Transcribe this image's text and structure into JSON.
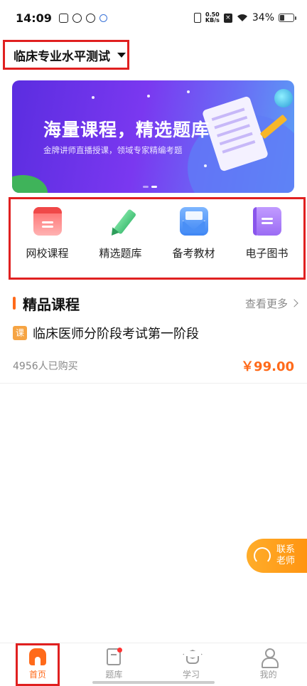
{
  "status_bar": {
    "time": "14:09",
    "net_speed_value": "0.50",
    "net_speed_unit": "KB/s",
    "battery": "34%",
    "battery_level": 0.34
  },
  "header": {
    "exam_selector": "临床专业水平测试"
  },
  "banner": {
    "title": "海量课程，精选题库",
    "subtitle": "金牌讲师直播授课，领域专家精编考题"
  },
  "quick_nav": [
    {
      "label": "网校课程",
      "icon": "online-course-icon"
    },
    {
      "label": "精选题库",
      "icon": "pencil-icon"
    },
    {
      "label": "备考教材",
      "icon": "envelope-icon"
    },
    {
      "label": "电子图书",
      "icon": "ebook-icon"
    }
  ],
  "section": {
    "title": "精品课程",
    "more": "查看更多"
  },
  "course": {
    "tag": "课",
    "title": "临床医师分阶段考试第一阶段",
    "buyers": "4956人已购买",
    "price": "￥99.00"
  },
  "contact": {
    "label": "联系老师"
  },
  "bottom_nav": [
    {
      "label": "首页",
      "icon": "home-icon",
      "active": true
    },
    {
      "label": "题库",
      "icon": "question-bank-icon",
      "badge": true
    },
    {
      "label": "学习",
      "icon": "graduation-cap-icon"
    },
    {
      "label": "我的",
      "icon": "user-icon"
    }
  ],
  "colors": {
    "accent": "#ff6a1a",
    "highlight_border": "#e02020",
    "banner_start": "#5b2de0",
    "banner_end": "#5aa0f5"
  }
}
